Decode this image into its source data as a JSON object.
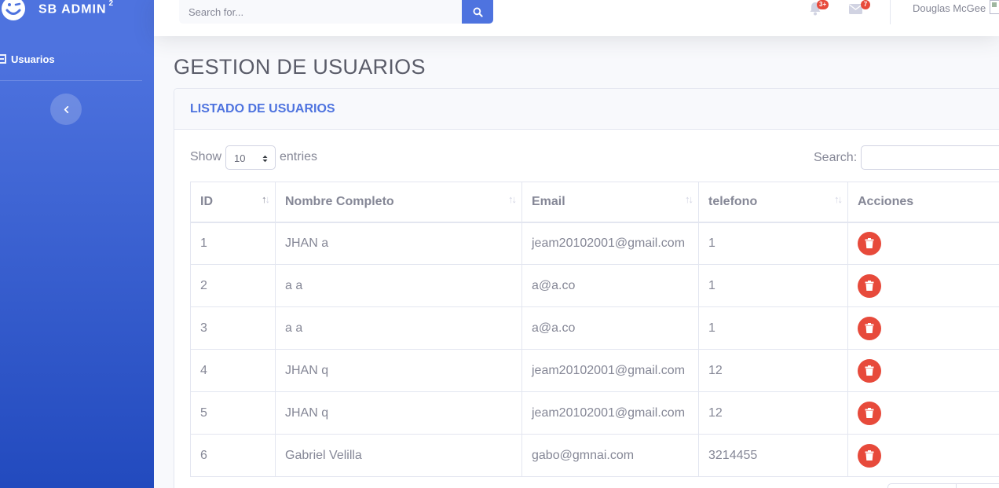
{
  "brand": {
    "name": "SB ADMIN",
    "sup": "2"
  },
  "sidebar": {
    "items": [
      {
        "label": "Usuarios",
        "icon": "table-icon"
      }
    ]
  },
  "topbar": {
    "search_placeholder": "Search for...",
    "alerts_count": "3+",
    "messages_count": "7",
    "user_name": "Douglas McGee"
  },
  "page": {
    "title": "GESTION DE USUARIOS"
  },
  "card": {
    "title": "LISTADO DE USUARIOS",
    "show_label": "Show",
    "entries_label": "entries",
    "page_length": "10",
    "search_label": "Search:"
  },
  "table": {
    "headers": [
      "ID",
      "Nombre Completo",
      "Email",
      "telefono",
      "Acciones"
    ],
    "rows": [
      {
        "id": "1",
        "name": "JHAN a",
        "email": "jeam20102001@gmail.com",
        "phone": "1"
      },
      {
        "id": "2",
        "name": "a a",
        "email": "a@a.co",
        "phone": "1"
      },
      {
        "id": "3",
        "name": "a a",
        "email": "a@a.co",
        "phone": "1"
      },
      {
        "id": "4",
        "name": "JHAN q",
        "email": "jeam20102001@gmail.com",
        "phone": "12"
      },
      {
        "id": "5",
        "name": "JHAN q",
        "email": "jeam20102001@gmail.com",
        "phone": "12"
      },
      {
        "id": "6",
        "name": "Gabriel Velilla",
        "email": "gabo@gmnai.com",
        "phone": "3214455"
      }
    ]
  },
  "colors": {
    "primary": "#4e73df",
    "danger": "#e74a3b",
    "text": "#858796"
  }
}
